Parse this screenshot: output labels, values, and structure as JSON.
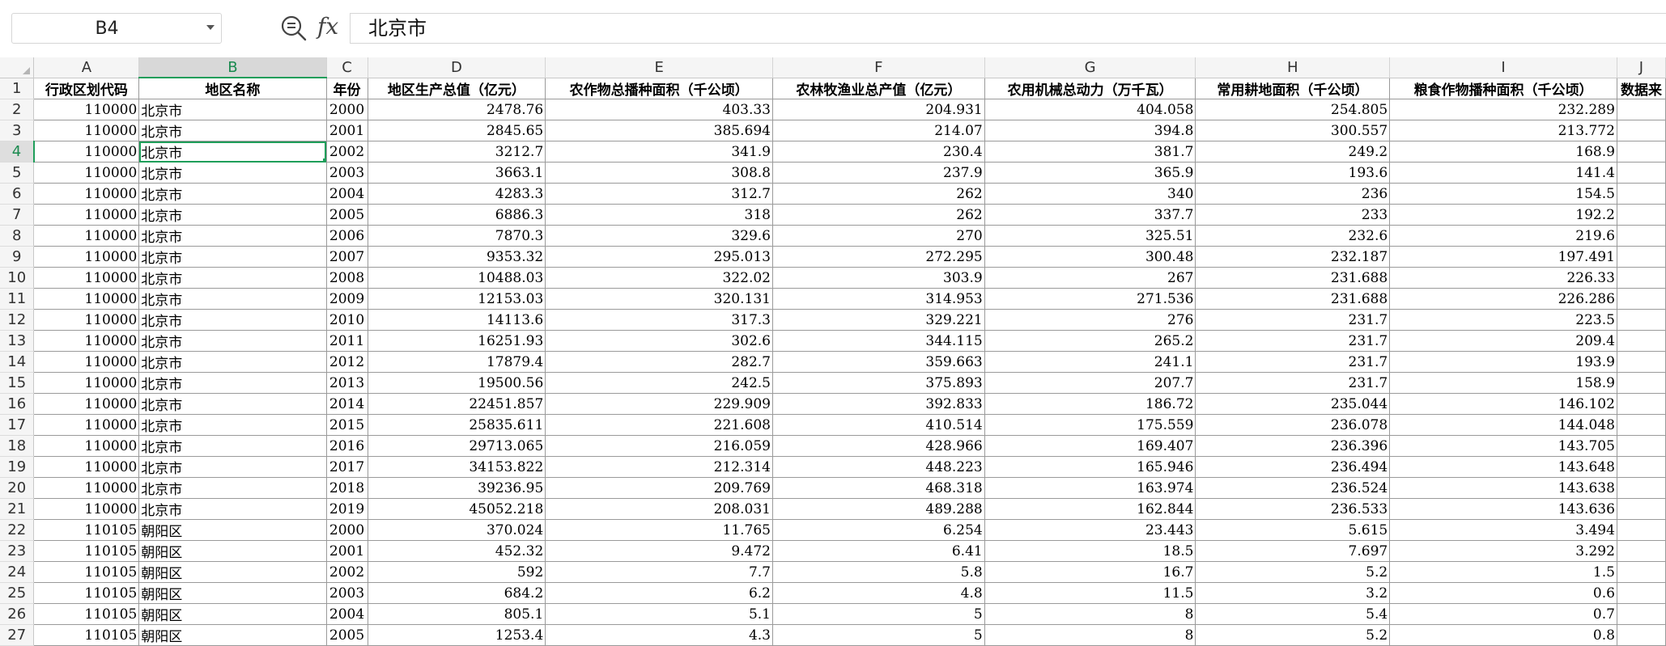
{
  "formula_bar": {
    "name_box": "B4",
    "fx_label": "fx",
    "value": "北京市"
  },
  "columns": [
    "A",
    "B",
    "C",
    "D",
    "E",
    "F",
    "G",
    "H",
    "I",
    "J"
  ],
  "header_row": [
    "行政区划代码",
    "地区名称",
    "年份",
    "地区生产总值（亿元）",
    "农作物总播种面积（千公顷）",
    "农林牧渔业总产值（亿元）",
    "农用机械总动力（万千瓦）",
    "常用耕地面积（千公顷）",
    "粮食作物播种面积（千公顷）",
    "数据来"
  ],
  "rows": [
    [
      "110000",
      "北京市",
      "2000",
      "2478.76",
      "403.33",
      "204.931",
      "404.058",
      "254.805",
      "232.289",
      ""
    ],
    [
      "110000",
      "北京市",
      "2001",
      "2845.65",
      "385.694",
      "214.07",
      "394.8",
      "300.557",
      "213.772",
      ""
    ],
    [
      "110000",
      "北京市",
      "2002",
      "3212.7",
      "341.9",
      "230.4",
      "381.7",
      "249.2",
      "168.9",
      ""
    ],
    [
      "110000",
      "北京市",
      "2003",
      "3663.1",
      "308.8",
      "237.9",
      "365.9",
      "193.6",
      "141.4",
      ""
    ],
    [
      "110000",
      "北京市",
      "2004",
      "4283.3",
      "312.7",
      "262",
      "340",
      "236",
      "154.5",
      ""
    ],
    [
      "110000",
      "北京市",
      "2005",
      "6886.3",
      "318",
      "262",
      "337.7",
      "233",
      "192.2",
      ""
    ],
    [
      "110000",
      "北京市",
      "2006",
      "7870.3",
      "329.6",
      "270",
      "325.51",
      "232.6",
      "219.6",
      ""
    ],
    [
      "110000",
      "北京市",
      "2007",
      "9353.32",
      "295.013",
      "272.295",
      "300.48",
      "232.187",
      "197.491",
      ""
    ],
    [
      "110000",
      "北京市",
      "2008",
      "10488.03",
      "322.02",
      "303.9",
      "267",
      "231.688",
      "226.33",
      ""
    ],
    [
      "110000",
      "北京市",
      "2009",
      "12153.03",
      "320.131",
      "314.953",
      "271.536",
      "231.688",
      "226.286",
      ""
    ],
    [
      "110000",
      "北京市",
      "2010",
      "14113.6",
      "317.3",
      "329.221",
      "276",
      "231.7",
      "223.5",
      ""
    ],
    [
      "110000",
      "北京市",
      "2011",
      "16251.93",
      "302.6",
      "344.115",
      "265.2",
      "231.7",
      "209.4",
      ""
    ],
    [
      "110000",
      "北京市",
      "2012",
      "17879.4",
      "282.7",
      "359.663",
      "241.1",
      "231.7",
      "193.9",
      ""
    ],
    [
      "110000",
      "北京市",
      "2013",
      "19500.56",
      "242.5",
      "375.893",
      "207.7",
      "231.7",
      "158.9",
      ""
    ],
    [
      "110000",
      "北京市",
      "2014",
      "22451.857",
      "229.909",
      "392.833",
      "186.72",
      "235.044",
      "146.102",
      ""
    ],
    [
      "110000",
      "北京市",
      "2015",
      "25835.611",
      "221.608",
      "410.514",
      "175.559",
      "236.078",
      "144.048",
      ""
    ],
    [
      "110000",
      "北京市",
      "2016",
      "29713.065",
      "216.059",
      "428.966",
      "169.407",
      "236.396",
      "143.705",
      ""
    ],
    [
      "110000",
      "北京市",
      "2017",
      "34153.822",
      "212.314",
      "448.223",
      "165.946",
      "236.494",
      "143.648",
      ""
    ],
    [
      "110000",
      "北京市",
      "2018",
      "39236.95",
      "209.769",
      "468.318",
      "163.974",
      "236.524",
      "143.638",
      ""
    ],
    [
      "110000",
      "北京市",
      "2019",
      "45052.218",
      "208.031",
      "489.288",
      "162.844",
      "236.533",
      "143.636",
      ""
    ],
    [
      "110105",
      "朝阳区",
      "2000",
      "370.024",
      "11.765",
      "6.254",
      "23.443",
      "5.615",
      "3.494",
      ""
    ],
    [
      "110105",
      "朝阳区",
      "2001",
      "452.32",
      "9.472",
      "6.41",
      "18.5",
      "7.697",
      "3.292",
      ""
    ],
    [
      "110105",
      "朝阳区",
      "2002",
      "592",
      "7.7",
      "5.8",
      "16.7",
      "5.2",
      "1.5",
      ""
    ],
    [
      "110105",
      "朝阳区",
      "2003",
      "684.2",
      "6.2",
      "4.8",
      "11.5",
      "3.2",
      "0.6",
      ""
    ],
    [
      "110105",
      "朝阳区",
      "2004",
      "805.1",
      "5.1",
      "5",
      "8",
      "5.4",
      "0.7",
      ""
    ],
    [
      "110105",
      "朝阳区",
      "2005",
      "1253.4",
      "4.3",
      "5",
      "8",
      "5.2",
      "0.8",
      ""
    ]
  ],
  "selection": {
    "column": "B",
    "row": 4
  }
}
